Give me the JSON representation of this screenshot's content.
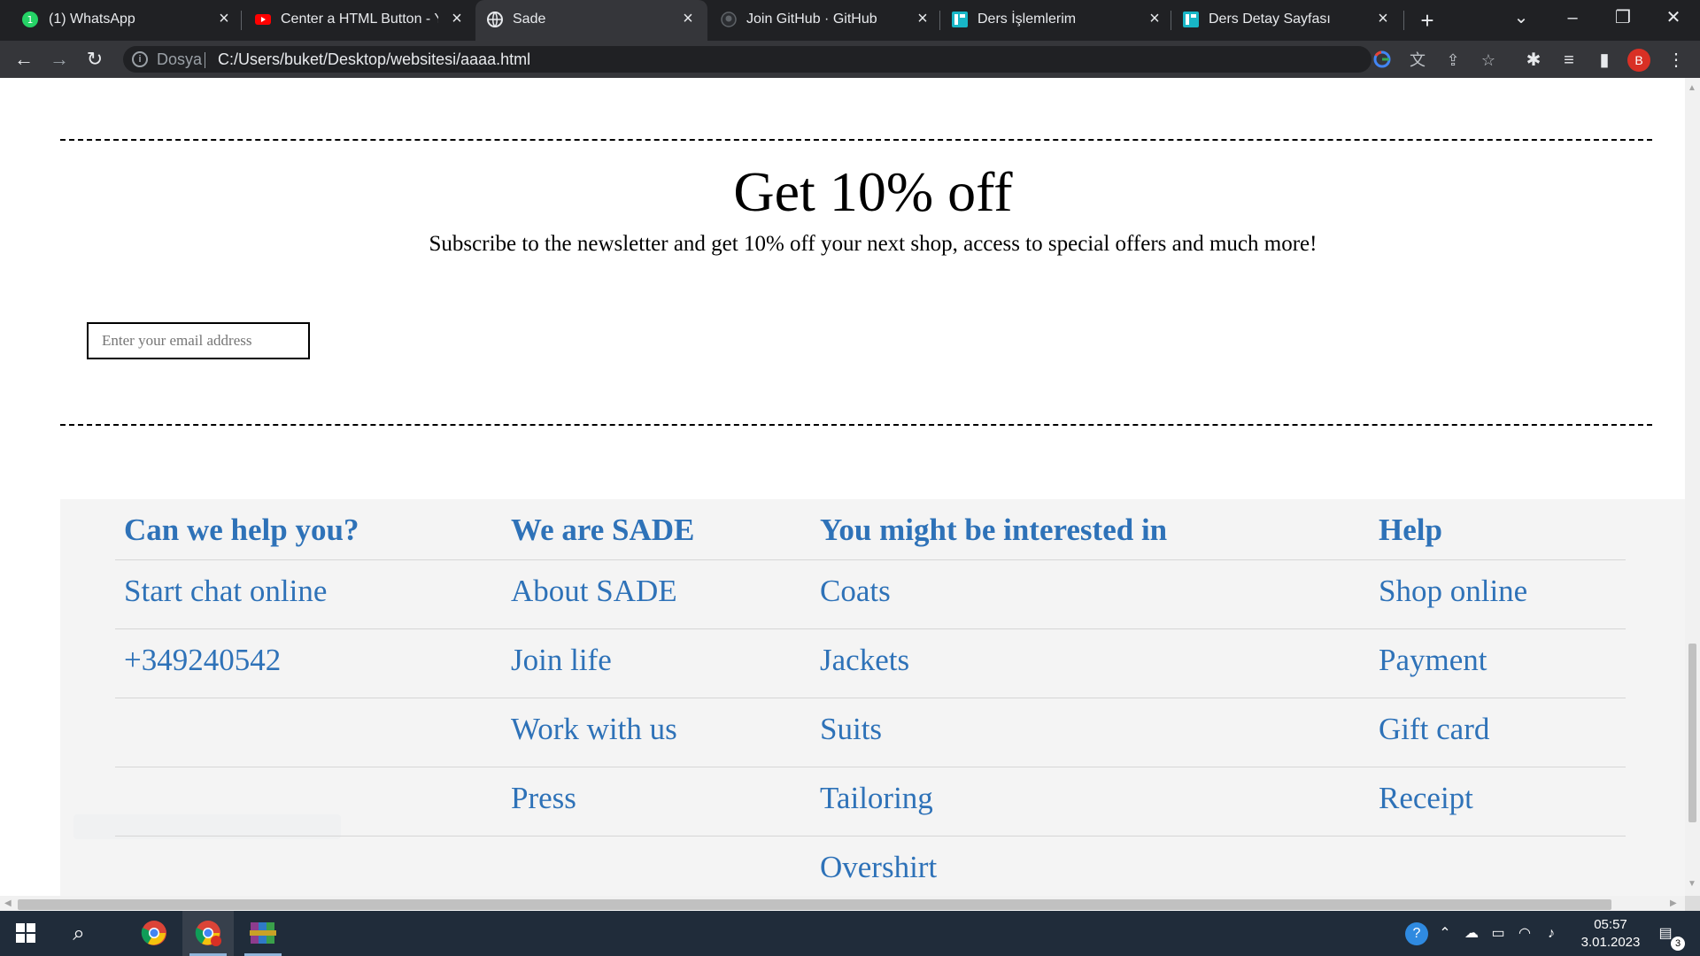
{
  "browser": {
    "tabs": [
      {
        "title": "(1) WhatsApp",
        "icon": "whatsapp-icon",
        "active": false
      },
      {
        "title": "Center a HTML Button - Yo",
        "icon": "youtube-icon",
        "active": false
      },
      {
        "title": "Sade",
        "icon": "globe-icon",
        "active": true
      },
      {
        "title": "Join GitHub · GitHub",
        "icon": "github-icon",
        "active": false
      },
      {
        "title": "Ders İşlemlerim",
        "icon": "course-app-icon",
        "active": false
      },
      {
        "title": "Ders Detay Sayfası",
        "icon": "course-app-icon",
        "active": false
      }
    ],
    "address": {
      "scheme_label": "Dosya",
      "url": "C:/Users/buket/Desktop/websitesi/aaaa.html"
    },
    "profile_initial": "B"
  },
  "page": {
    "promo": {
      "title": "Get 10% off",
      "subtitle": "Subscribe to the newsletter and get 10% off your next shop, access to special offers and much more!",
      "email_placeholder": "Enter your email address"
    },
    "footer": {
      "columns": [
        {
          "heading": "Can we help you?",
          "links": [
            "Start chat online",
            "+349240542"
          ]
        },
        {
          "heading": "We are SADE",
          "links": [
            "About SADE",
            "Join life",
            "Work with us",
            "Press"
          ]
        },
        {
          "heading": "You might be interested in",
          "links": [
            "Coats",
            "Jackets",
            "Suits",
            "Tailoring",
            "Overshirt"
          ]
        },
        {
          "heading": "Help",
          "links": [
            "Shop online",
            "Payment",
            "Gift card",
            "Receipt"
          ]
        }
      ],
      "link_color": "#2e72b8",
      "background": "#f4f4f4"
    }
  },
  "taskbar": {
    "time": "05:57",
    "date": "3.01.2023",
    "notification_count": "3"
  }
}
